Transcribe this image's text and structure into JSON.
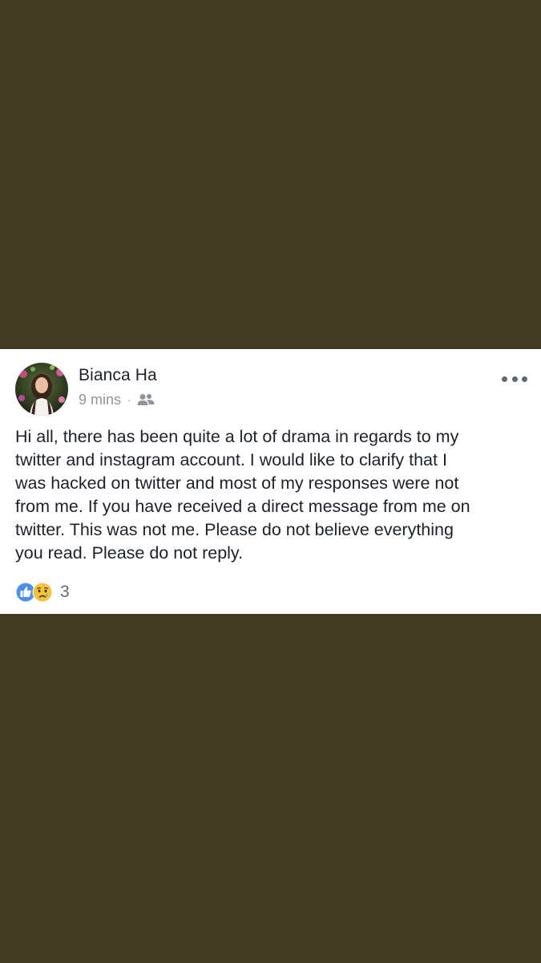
{
  "post": {
    "author": "Bianca Ha",
    "time": "9 mins",
    "separator": "·",
    "audience_icon": "friends-icon",
    "text": "Hi all, there has been quite a lot of drama in regards to my\ntwitter and instagram account. I would like to clarify that I\nwas hacked on twitter and most of my responses were not\nfrom me. If you have received a direct message from me on\ntwitter. This was not me. Please do not believe everything\nyou read. Please do not reply.",
    "reactions": {
      "icons": [
        "like-icon",
        "sad-icon"
      ],
      "count": "3"
    }
  },
  "colors": {
    "background": "#403b22",
    "card": "#ffffff",
    "text": "#1d2129",
    "meta": "#90949c",
    "like_blue": "#4a90f0",
    "sad_yellow": "#f5c33b"
  }
}
